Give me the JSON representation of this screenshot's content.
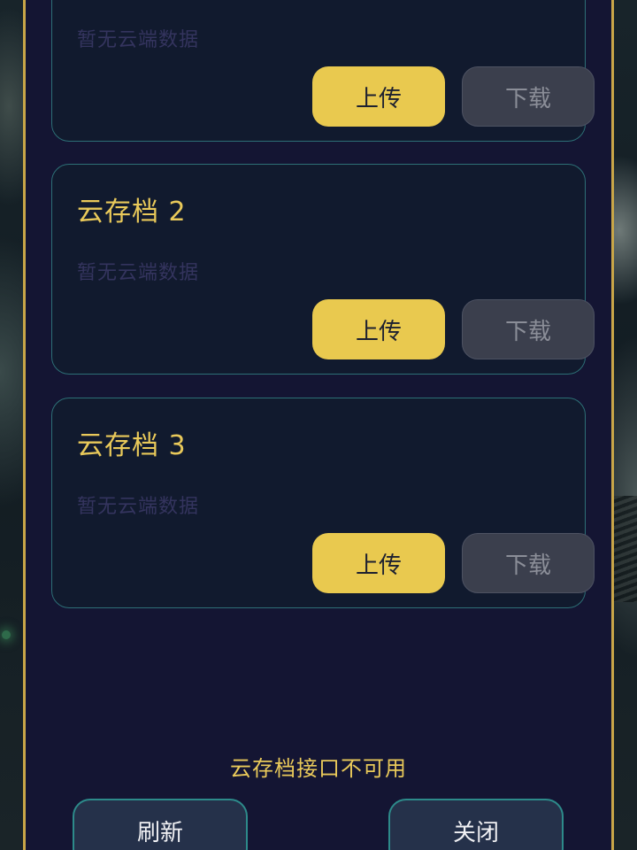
{
  "slots": [
    {
      "title": "",
      "status": "暂无云端数据",
      "upload_label": "上传",
      "download_label": "下载"
    },
    {
      "title": "云存档 2",
      "status": "暂无云端数据",
      "upload_label": "上传",
      "download_label": "下载"
    },
    {
      "title": "云存档 3",
      "status": "暂无云端数据",
      "upload_label": "上传",
      "download_label": "下载"
    }
  ],
  "footer": {
    "status_text": "云存档接口不可用",
    "refresh_label": "刷新",
    "close_label": "关闭"
  },
  "colors": {
    "accent_gold": "#e9c95a",
    "panel_bg": "#141533",
    "slot_border": "#2d6f76",
    "upload_bg": "#e9c94f",
    "download_bg": "#3b3f4d"
  }
}
